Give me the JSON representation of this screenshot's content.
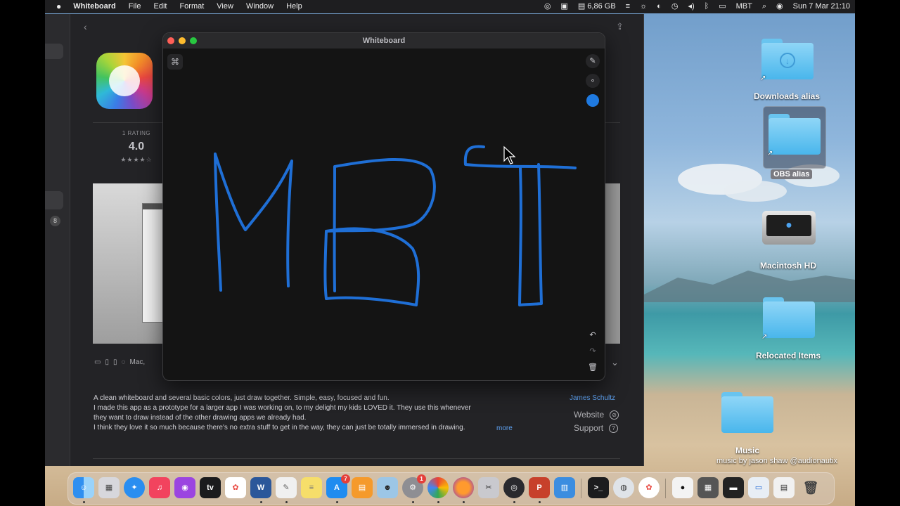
{
  "menubar": {
    "app": "Whiteboard",
    "menus": [
      "File",
      "Edit",
      "Format",
      "View",
      "Window",
      "Help"
    ],
    "memory": "6,86 GB",
    "keyboard": "MBT",
    "datetime": "Sun 7 Mar  21:10"
  },
  "store": {
    "rating_count": "1 RATING",
    "rating_value": "4.0",
    "rating_stars": "★★★★☆",
    "sidebar_badge": "8",
    "device_label": "Mac,",
    "description_lines": [
      "A clean whiteboard and several basic colors, just draw together. Simple, easy, focused and fun.",
      "I made this app as a prototype for a larger app I was working on, to my delight my kids LOVED it. They use this whenever",
      "they want to draw instead of the other drawing apps we already had.",
      "I think they love it so much because there's no extra stuff to get in the way, they can just be totally immersed in drawing."
    ],
    "more": "more",
    "developer": "James Schultz",
    "website": "Website",
    "support": "Support"
  },
  "whiteboard": {
    "title": "Whiteboard",
    "cmd_symbol": "⌘",
    "pen_color": "#1f7ae0",
    "stroke_color": "#1f6fd6"
  },
  "desktop": {
    "downloads": "Downloads alias",
    "obs": "OBS alias",
    "macintosh": "Macintosh HD",
    "relocated": "Relocated Items",
    "music": "Music",
    "watermark": "music by jason shaw @audionautix"
  },
  "dock": {
    "appstore_badge": "7",
    "sysprefs_badge": "1"
  }
}
